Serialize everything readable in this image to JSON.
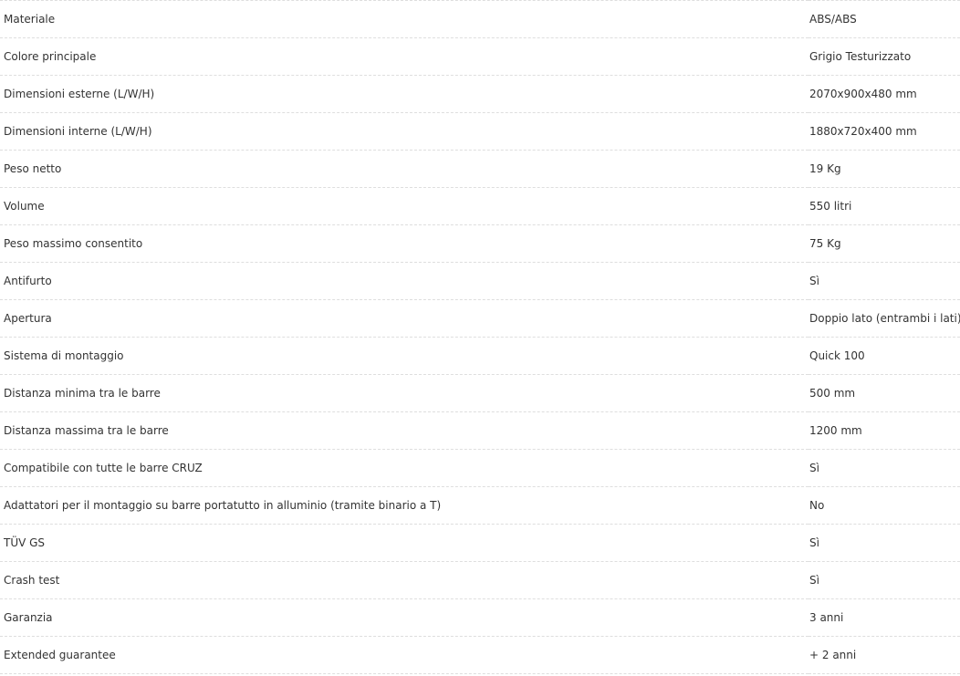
{
  "specs": [
    {
      "label": "Materiale",
      "value": "ABS/ABS"
    },
    {
      "label": "Colore principale",
      "value": "Grigio Testurizzato"
    },
    {
      "label": "Dimensioni esterne (L/W/H)",
      "value": "2070x900x480 mm"
    },
    {
      "label": "Dimensioni interne (L/W/H)",
      "value": "1880x720x400 mm"
    },
    {
      "label": "Peso netto",
      "value": "19 Kg"
    },
    {
      "label": "Volume",
      "value": "550 litri"
    },
    {
      "label": "Peso massimo consentito",
      "value": "75 Kg"
    },
    {
      "label": "Antifurto",
      "value": "Sì"
    },
    {
      "label": "Apertura",
      "value": "Doppio lato (entrambi i lati)"
    },
    {
      "label": "Sistema di montaggio",
      "value": "Quick 100"
    },
    {
      "label": "Distanza minima tra le barre",
      "value": "500 mm"
    },
    {
      "label": "Distanza massima tra le barre",
      "value": "1200 mm"
    },
    {
      "label": "Compatibile con tutte le barre CRUZ",
      "value": "Sì"
    },
    {
      "label": "Adattatori per il montaggio su barre portatutto in alluminio (tramite binario a T)",
      "value": "No"
    },
    {
      "label": "TÜV GS",
      "value": "Sì"
    },
    {
      "label": "Crash test",
      "value": "Sì"
    },
    {
      "label": "Garanzia",
      "value": "3 anni"
    },
    {
      "label": "Extended guarantee",
      "value": "+ 2 anni"
    }
  ]
}
